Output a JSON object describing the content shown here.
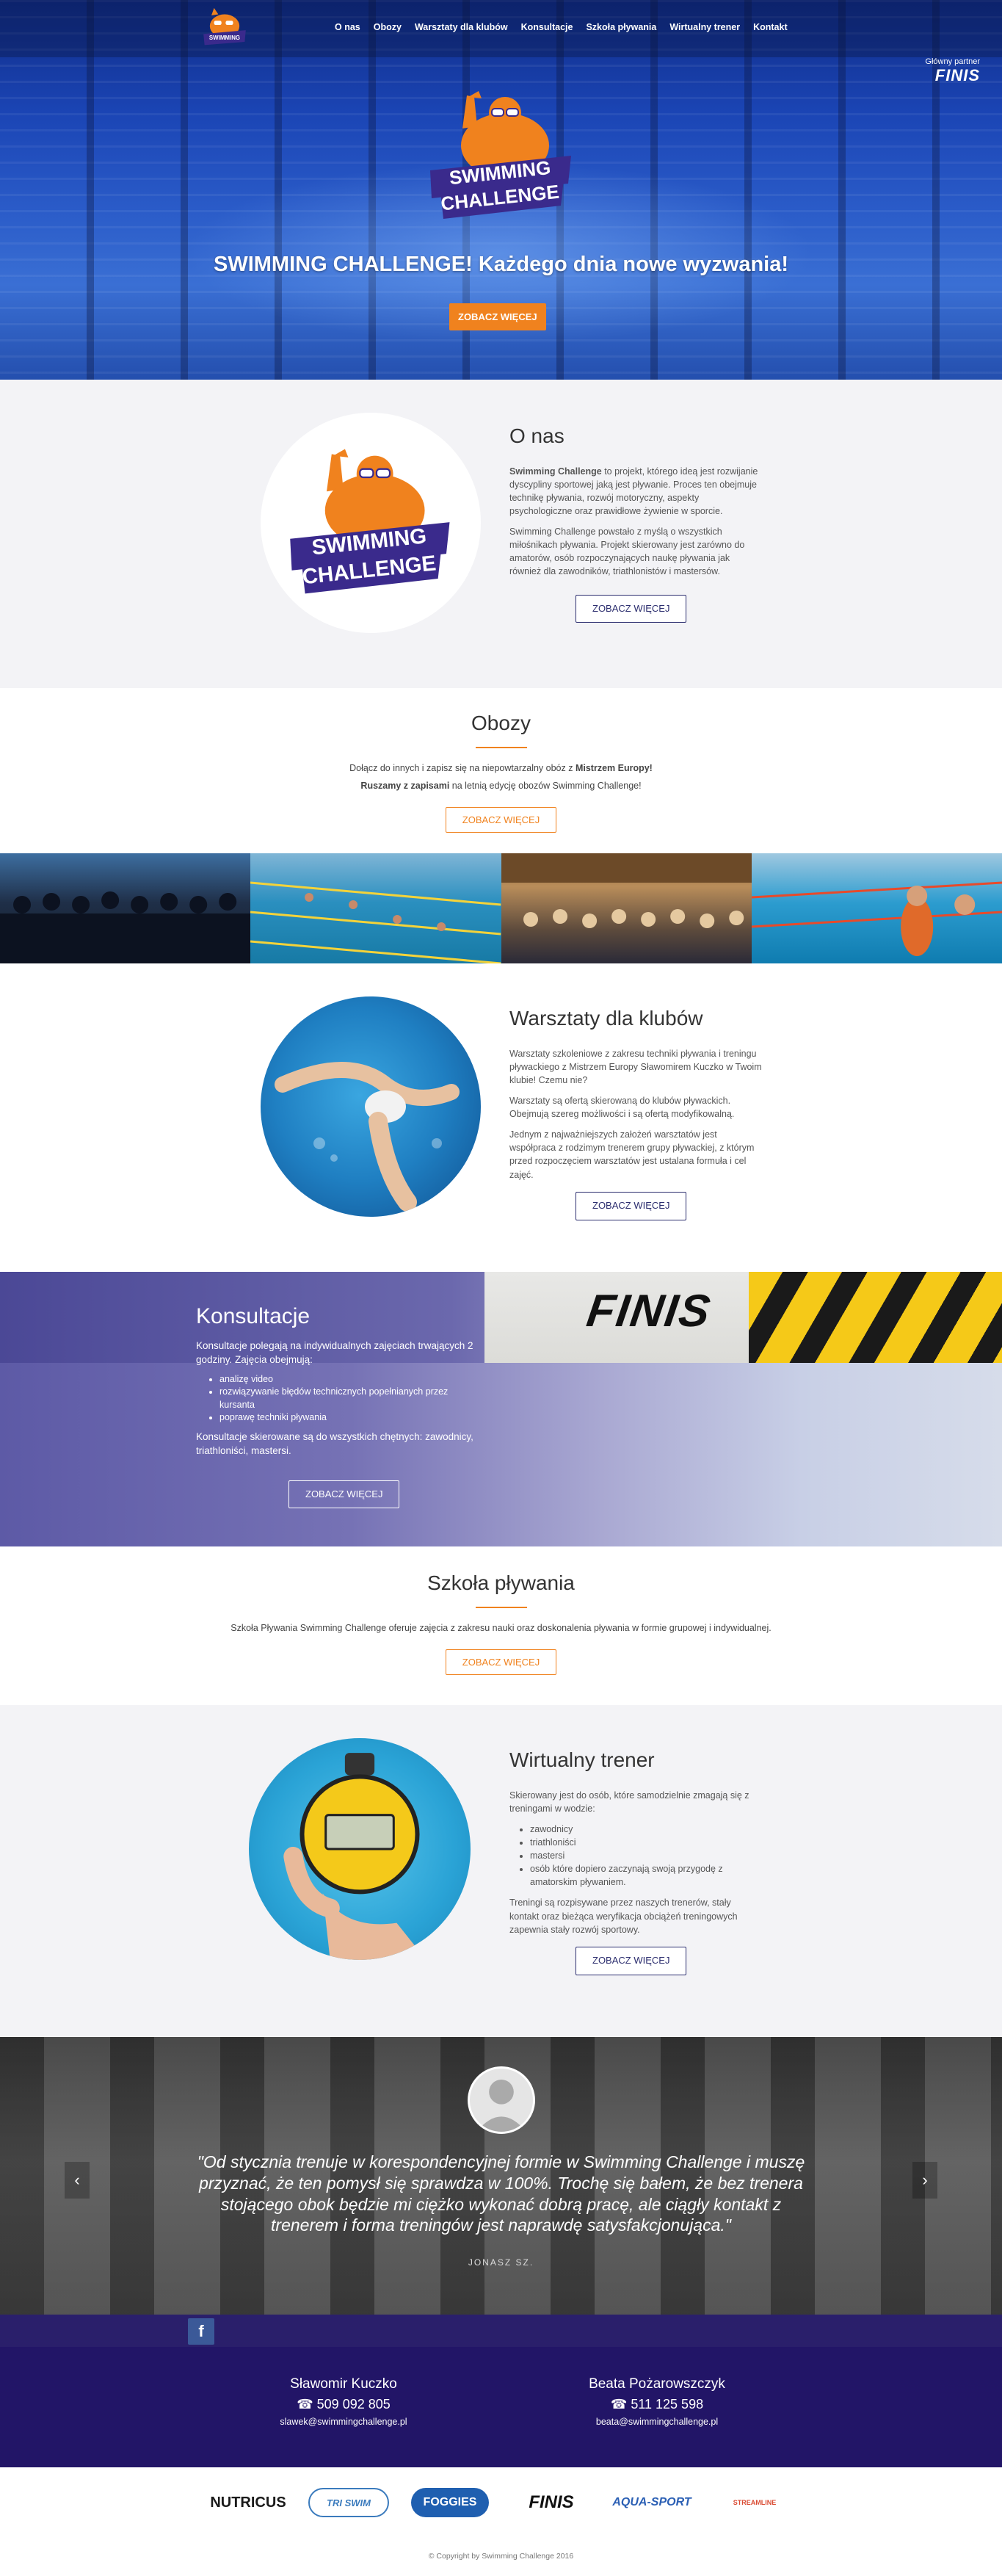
{
  "nav": {
    "items": [
      "O nas",
      "Obozy",
      "Warsztaty dla klubów",
      "Konsultacje",
      "Szkoła pływania",
      "Wirtualny trener",
      "Kontakt"
    ]
  },
  "partner": {
    "label": "Główny partner",
    "brand": "FINIS"
  },
  "logo": {
    "line1": "SWIMMING",
    "line2": "CHALLENGE"
  },
  "hero": {
    "title": "SWIMMING CHALLENGE! Każdego dnia nowe wyzwania!",
    "cta": "ZOBACZ WIĘCEJ"
  },
  "onas": {
    "title": "O nas",
    "p1_bold": "Swimming Challenge",
    "p1_rest": " to projekt, którego ideą jest rozwijanie dyscypliny sportowej jaką jest pływanie. Proces ten obejmuje technikę pływania, rozwój motoryczny, aspekty psychologiczne oraz prawidłowe żywienie w sporcie.",
    "p2": "Swimming Challenge powstało z myślą o wszystkich miłośnikach pływania. Projekt skierowany jest zarówno do amatorów, osób rozpoczynających naukę pływania jak również dla zawodników, triathlonistów i mastersów.",
    "cta": "ZOBACZ WIĘCEJ"
  },
  "obozy": {
    "title": "Obozy",
    "line1_a": "Dołącz do innych i zapisz się na niepowtarzalny obóz z ",
    "line1_b": "Mistrzem Europy!",
    "line2_a": "Ruszamy z zapisami",
    "line2_b": " na letnią edycję obozów Swimming Challenge!",
    "cta": "ZOBACZ WIĘCEJ"
  },
  "warsztaty": {
    "title": "Warsztaty dla klubów",
    "p1": "Warsztaty szkoleniowe z zakresu techniki pływania i treningu pływackiego z Mistrzem Europy Sławomirem Kuczko w Twoim klubie! Czemu nie?",
    "p2": "Warsztaty są ofertą skierowaną do klubów pływackich. Obejmują szereg możliwości i są ofertą modyfikowalną.",
    "p3": "Jednym z najważniejszych założeń warsztatów jest współpraca z rodzimym trenerem grupy pływackiej, z którym przed rozpoczęciem warsztatów jest ustalana formuła i cel zajęć.",
    "cta": "ZOBACZ WIĘCEJ"
  },
  "konsultacje": {
    "title": "Konsultacje",
    "intro": "Konsultacje polegają na indywidualnych zajęciach trwających 2 godziny. Zajęcia obejmują:",
    "items": [
      "analizę video",
      "rozwiązywanie błędów technicznych popełnianych przez kursanta",
      "poprawę techniki pływania"
    ],
    "outro": "Konsultacje skierowane są do wszystkich chętnych: zawodnicy, triathloniści, mastersi.",
    "cta": "ZOBACZ WIĘCEJ",
    "photo_brand": "FINIS"
  },
  "szkola": {
    "title": "Szkoła pływania",
    "text": "Szkoła Pływania Swimming Challenge oferuje zajęcia z zakresu nauki oraz doskonalenia pływania w formie grupowej i indywidualnej.",
    "cta": "ZOBACZ WIĘCEJ"
  },
  "wirtualny": {
    "title": "Wirtualny trener",
    "intro": "Skierowany jest do osób, które samodzielnie zmagają się z treningami w wodzie:",
    "items": [
      "zawodnicy",
      "triathloniści",
      "mastersi",
      "osób które dopiero zaczynają swoją przygodę z amatorskim pływaniem."
    ],
    "outro": "Treningi są rozpisywane przez naszych trenerów, stały kontakt oraz bieżąca weryfikacja obciążeń treningowych zapewnia stały rozwój sportowy.",
    "cta": "ZOBACZ WIĘCEJ"
  },
  "testimonial": {
    "quote": "\"Od stycznia trenuje w korespondencyjnej formie w Swimming Challenge i muszę przyznać, że ten pomysł się sprawdza w 100%. Trochę się bałem, że bez trenera stojącego obok będzie mi ciężko wykonać dobrą pracę, ale ciągły kontakt z trenerem i forma treningów jest naprawdę satysfakcjonująca.\"",
    "author": "JONASZ SZ.",
    "prev": "‹",
    "next": "›"
  },
  "social": {
    "facebook": "f"
  },
  "contacts": [
    {
      "name": "Sławomir Kuczko",
      "phone": "509 092 805",
      "email": "slawek@swimmingchallenge.pl"
    },
    {
      "name": "Beata Pożarowszczyk",
      "phone": "511 125 598",
      "email": "beata@swimmingchallenge.pl"
    }
  ],
  "sponsors": [
    "NUTRICUS",
    "TRI SWIM",
    "FOGGIES",
    "FINIS",
    "AQUA-SPORT",
    "STREAMLINE"
  ],
  "footer": {
    "copyright": "© Copyright by Swimming Challenge 2016"
  },
  "colors": {
    "accent": "#f0821e",
    "navy": "#2b2d6e",
    "footer": "#221567"
  }
}
